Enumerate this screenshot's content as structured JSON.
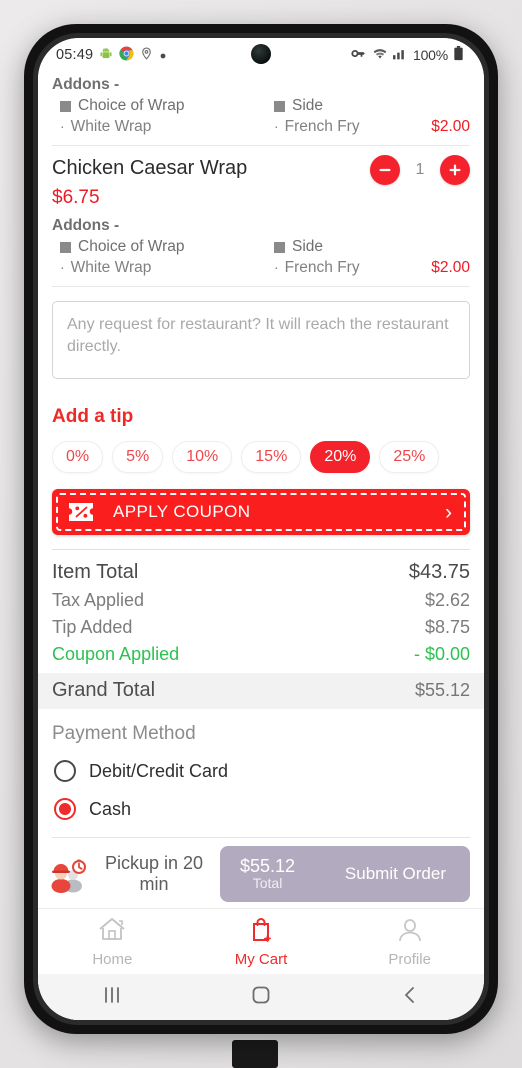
{
  "status_bar": {
    "time": "05:49",
    "left_icons": [
      "android-icon",
      "chrome-icon",
      "location-pin-icon",
      "dot-icon"
    ],
    "right_icons": [
      "vpn-key-icon",
      "wifi-icon",
      "cellular-signal-icon"
    ],
    "battery": "100%"
  },
  "cart": {
    "items": [
      {
        "addons_label": "Addons -",
        "groups": [
          {
            "title": "Choice of Wrap",
            "option": "White Wrap",
            "price": ""
          },
          {
            "title": "Side",
            "option": "French Fry",
            "price": "$2.00"
          }
        ]
      },
      {
        "name": "Chicken Caesar Wrap",
        "price": "$6.75",
        "quantity": "1",
        "addons_label": "Addons -",
        "groups": [
          {
            "title": "Choice of Wrap",
            "option": "White Wrap",
            "price": ""
          },
          {
            "title": "Side",
            "option": "French Fry",
            "price": "$2.00"
          }
        ]
      }
    ]
  },
  "request": {
    "placeholder": "Any request for restaurant? It will reach the restaurant directly.",
    "value": ""
  },
  "tip": {
    "title": "Add a tip",
    "options": [
      "0%",
      "5%",
      "10%",
      "15%",
      "20%",
      "25%"
    ],
    "selected": "20%"
  },
  "coupon": {
    "label": "APPLY COUPON",
    "chevron": "›",
    "icon": "coupon-ticket-icon"
  },
  "totals": {
    "rows": [
      {
        "label": "Item Total",
        "value": "$43.75"
      },
      {
        "label": "Tax Applied",
        "value": "$2.62"
      },
      {
        "label": "Tip Added",
        "value": "$8.75"
      },
      {
        "label": "Coupon Applied",
        "value": "- $0.00"
      }
    ],
    "grand": {
      "label": "Grand Total",
      "value": "$55.12"
    }
  },
  "payment": {
    "title": "Payment Method",
    "options": [
      {
        "label": "Debit/Credit Card",
        "selected": false
      },
      {
        "label": "Cash",
        "selected": true
      }
    ]
  },
  "submit": {
    "pickup_text": "Pickup in 20 min",
    "amount": "$55.12",
    "total_label": "Total",
    "button_label": "Submit Order"
  },
  "bottom_nav": {
    "items": [
      {
        "label": "Home",
        "icon": "home-icon",
        "active": false
      },
      {
        "label": "My Cart",
        "icon": "shopping-bag-plus-icon",
        "active": true
      },
      {
        "label": "Profile",
        "icon": "person-icon",
        "active": false
      }
    ]
  },
  "system_nav": {
    "recents": "recents-icon",
    "home": "home-square-icon",
    "back": "back-chevron-icon"
  },
  "colors": {
    "brand_red": "#ef2b2b",
    "coupon_red": "#fb1e1e",
    "coupon_green": "#2ec152",
    "submit_purple": "#b2aabf"
  }
}
